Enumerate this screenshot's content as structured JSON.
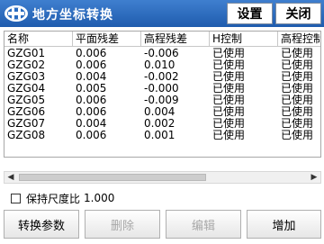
{
  "window": {
    "title": "地方坐标转换",
    "settings_label": "设置",
    "close_label": "关闭",
    "logo_icon": "hi-target-logo-icon"
  },
  "table": {
    "columns": [
      "名称",
      "平面残差",
      "高程残差",
      "H控制",
      "高程控制"
    ],
    "rows": [
      [
        "GZG01",
        "0.006",
        "-0.006",
        "已使用",
        "已使用"
      ],
      [
        "GZG02",
        "0.006",
        "0.010",
        "已使用",
        "已使用"
      ],
      [
        "GZG03",
        "0.004",
        "-0.002",
        "已使用",
        "已使用"
      ],
      [
        "GZG04",
        "0.005",
        "-0.000",
        "已使用",
        "已使用"
      ],
      [
        "GZG05",
        "0.006",
        "-0.009",
        "已使用",
        "已使用"
      ],
      [
        "GZG06",
        "0.006",
        "0.004",
        "已使用",
        "已使用"
      ],
      [
        "GZG07",
        "0.004",
        "0.002",
        "已使用",
        "已使用"
      ],
      [
        "GZG08",
        "0.006",
        "0.001",
        "已使用",
        "已使用"
      ]
    ]
  },
  "scale": {
    "label": "保持尺度比",
    "value": "1.000",
    "checked": false
  },
  "buttons": {
    "convert_params": "转换参数",
    "delete": "删除",
    "edit": "编辑",
    "add": "增加"
  },
  "colors": {
    "titlebar": "#2a6cc0",
    "disabled_text": "#a8a8a8"
  }
}
